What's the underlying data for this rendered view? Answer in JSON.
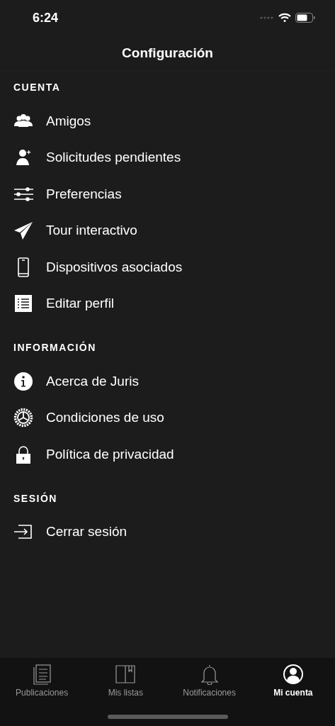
{
  "status_bar": {
    "time": "6:24"
  },
  "title": "Configuración",
  "sections": [
    {
      "header": "CUENTA",
      "items": [
        {
          "label": "Amigos",
          "kind": "people"
        },
        {
          "label": "Solicitudes pendientes",
          "kind": "person-add"
        },
        {
          "label": "Preferencias",
          "kind": "sliders"
        },
        {
          "label": "Tour interactivo",
          "kind": "plane"
        },
        {
          "label": "Dispositivos asociados",
          "kind": "phone"
        },
        {
          "label": "Editar perfil",
          "kind": "list"
        }
      ]
    },
    {
      "header": "INFORMACIÓN",
      "items": [
        {
          "label": "Acerca de Juris",
          "kind": "info"
        },
        {
          "label": "Condiciones de uso",
          "kind": "gear"
        },
        {
          "label": "Política de privacidad",
          "kind": "lock"
        }
      ]
    },
    {
      "header": "SESIÓN",
      "items": [
        {
          "label": "Cerrar sesión",
          "kind": "logout"
        }
      ]
    }
  ],
  "tabs": [
    {
      "label": "Publicaciones",
      "kind": "document",
      "selected": false
    },
    {
      "label": "Mis listas",
      "kind": "book",
      "selected": false
    },
    {
      "label": "Notificaciones",
      "kind": "bell",
      "selected": false
    },
    {
      "label": "Mi cuenta",
      "kind": "account",
      "selected": true
    }
  ]
}
